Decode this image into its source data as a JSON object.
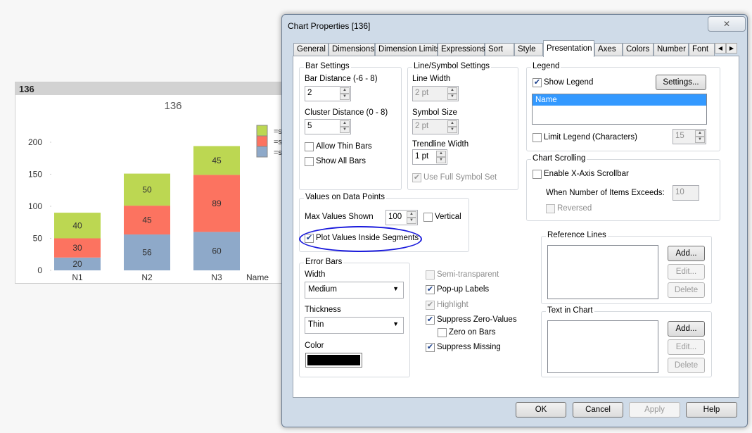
{
  "chart_panel": {
    "caption": "136",
    "chart_data": {
      "type": "bar",
      "stacked": true,
      "title": "136",
      "xlabel": "Name",
      "categories": [
        "N1",
        "N2",
        "N3"
      ],
      "series": [
        {
          "values": [
            20,
            56,
            60
          ],
          "color": "#8ea9c9"
        },
        {
          "values": [
            30,
            45,
            89
          ],
          "color": "#fc7360"
        },
        {
          "values": [
            40,
            50,
            45
          ],
          "color": "#bcd752"
        }
      ],
      "ylim": [
        0,
        200
      ],
      "yticks": [
        "0",
        "50",
        "100",
        "150",
        "200"
      ],
      "legend": {
        "placement": "top-right",
        "entries": [
          "=s",
          "=s",
          "=s"
        ]
      }
    }
  },
  "dialog": {
    "title": "Chart Properties [136]",
    "close": "✕",
    "tabs": [
      "General",
      "Dimensions",
      "Dimension Limits",
      "Expressions",
      "Sort",
      "Style",
      "Presentation",
      "Axes",
      "Colors",
      "Number",
      "Font"
    ],
    "active_tab": "Presentation",
    "bar_settings": {
      "title": "Bar Settings",
      "bar_distance_label": "Bar Distance (-6 - 8)",
      "bar_distance": "2",
      "cluster_distance_label": "Cluster Distance (0 - 8)",
      "cluster_distance": "5",
      "allow_thin_bars": "Allow Thin Bars",
      "show_all_bars": "Show All Bars"
    },
    "line_symbol": {
      "title": "Line/Symbol Settings",
      "line_width_label": "Line Width",
      "line_width": "2 pt",
      "symbol_size_label": "Symbol Size",
      "symbol_size": "2 pt",
      "trendline_width_label": "Trendline Width",
      "trendline_width": "1 pt",
      "use_full_symbol_set": "Use Full Symbol Set"
    },
    "legend": {
      "title": "Legend",
      "show_legend": "Show Legend",
      "settings": "Settings...",
      "list": [
        "Name"
      ],
      "limit_legend": "Limit Legend (Characters)",
      "limit_value": "15"
    },
    "chart_scrolling": {
      "title": "Chart Scrolling",
      "enable": "Enable X-Axis Scrollbar",
      "exceeds_label": "When Number of Items Exceeds:",
      "exceeds_value": "10",
      "reversed": "Reversed"
    },
    "values_on_points": {
      "title": "Values on Data Points",
      "max_label": "Max Values Shown",
      "max_value": "100",
      "vertical": "Vertical",
      "plot_inside": "Plot Values Inside Segments"
    },
    "error_bars": {
      "title": "Error Bars",
      "width_label": "Width",
      "width": "Medium",
      "thickness_label": "Thickness",
      "thickness": "Thin",
      "color_label": "Color",
      "color": "#000000"
    },
    "options": {
      "semi_transparent": "Semi-transparent",
      "popup_labels": "Pop-up Labels",
      "highlight": "Highlight",
      "suppress_zero": "Suppress Zero-Values",
      "zero_on_bars": "Zero on Bars",
      "suppress_missing": "Suppress Missing"
    },
    "reference_lines": {
      "title": "Reference Lines",
      "add": "Add...",
      "edit": "Edit...",
      "delete": "Delete"
    },
    "text_in_chart": {
      "title": "Text in Chart",
      "add": "Add...",
      "edit": "Edit...",
      "delete": "Delete"
    },
    "buttons": {
      "ok": "OK",
      "cancel": "Cancel",
      "apply": "Apply",
      "help": "Help"
    },
    "annotation_color": "#1a1adc"
  }
}
